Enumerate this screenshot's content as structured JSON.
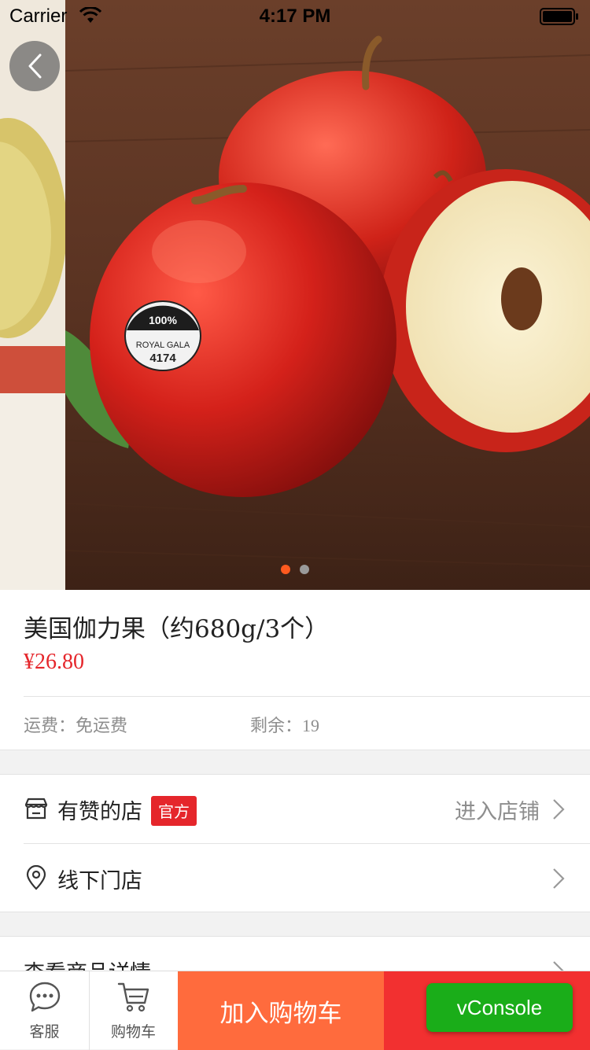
{
  "status_bar": {
    "carrier": "Carrier",
    "time": "4:17 PM"
  },
  "carousel": {
    "slide_count": 2,
    "active_index": 0,
    "image": "product-photo-apples"
  },
  "product": {
    "title": "美国伽力果（约680g/3个）",
    "price": "¥26.80",
    "shipping_label": "运费：",
    "shipping_value": "免运费",
    "stock_label": "剩余：",
    "stock_value": "19"
  },
  "shop_rows": [
    {
      "icon": "store-icon",
      "label": "有赞的店",
      "badge": "官方",
      "trail": "进入店铺"
    },
    {
      "icon": "location-pin-icon",
      "label": "线下门店",
      "badge": "",
      "trail": ""
    }
  ],
  "detail_row": {
    "label": "查看商品详情"
  },
  "bottom_bar": {
    "service_label": "客服",
    "cart_label": "购物车",
    "add_to_cart_label": "加入购物车",
    "buy_now_label": ""
  },
  "vconsole_label": "vConsole",
  "colors": {
    "price_red": "#e5262b",
    "add_cart_orange": "#ff6b3d",
    "buy_red": "#f23030",
    "vconsole_green": "#1aad19",
    "dot_active": "#ff5a1f"
  }
}
